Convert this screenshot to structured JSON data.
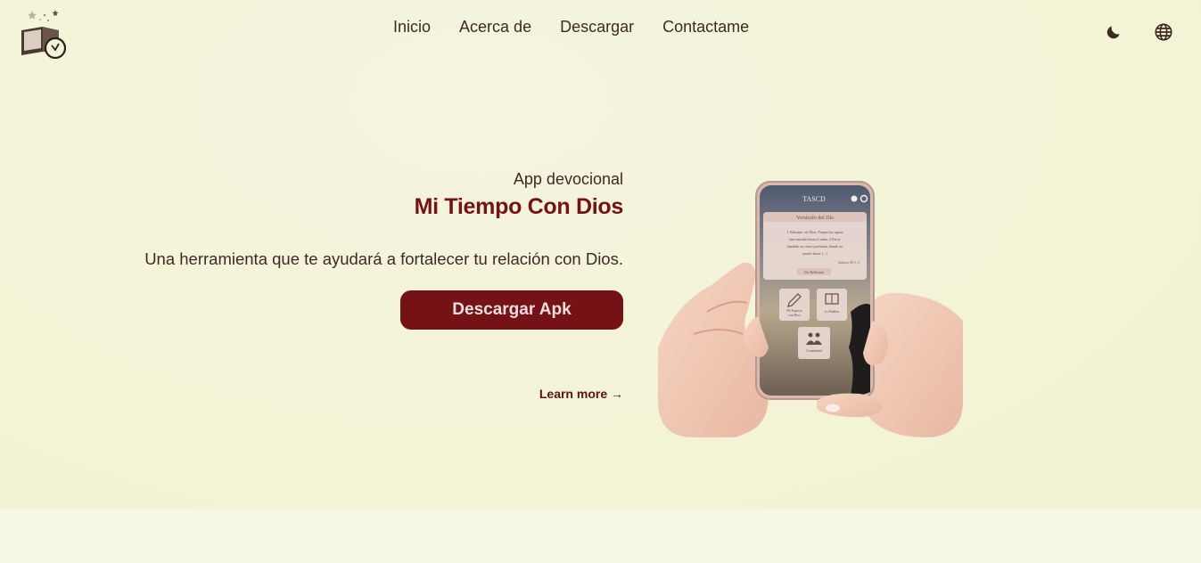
{
  "nav": {
    "items": [
      "Inicio",
      "Acerca de",
      "Descargar",
      "Contactame"
    ]
  },
  "hero": {
    "subtitle": "App devocional",
    "title": "Mi Tiempo Con Dios",
    "description": "Una herramienta que te ayudará a fortalecer tu relación con Dios.",
    "cta_label": "Descargar Apk",
    "learn_more": "Learn more →"
  },
  "phone": {
    "app_title": "TASCD",
    "verse_header": "Versículo del Día",
    "verse_text_1": "1 Sálvame, oh Dios, Porque las aguas",
    "verse_text_2": "han entrado hasta el alma. 2 Estoy",
    "verse_text_3": "hundido en cieno profundo, donde no",
    "verse_text_4": "puedo hacer [...]",
    "verse_ref": "Salmos 69:1, 2",
    "reflection_btn": "Ver Reflexión",
    "tile1_line1": "Mi Espacio",
    "tile1_line2": "con Dios",
    "tile2": "La Palabra",
    "tile3": "Comunidad"
  },
  "icons": {
    "theme": "moon-icon",
    "language": "globe-icon",
    "logo": "book-clock-logo"
  },
  "colors": {
    "accent": "#741216",
    "background": "#f3f3d8",
    "text": "#3d2a22"
  }
}
